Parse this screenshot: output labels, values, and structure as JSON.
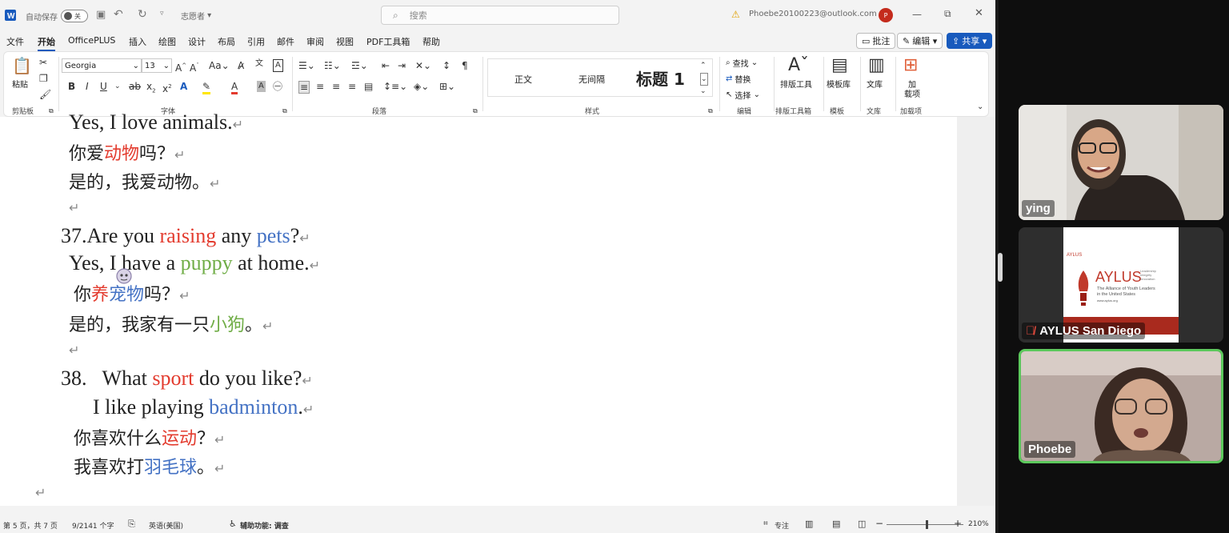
{
  "titlebar": {
    "autosave_label": "自动保存",
    "autosave_state": "关",
    "doc_name": "志愿者",
    "search_placeholder": "搜索",
    "account": "Phoebe20100223@outlook.com",
    "avatar_letter": "P"
  },
  "menu": [
    "文件",
    "开始",
    "OfficePLUS",
    "插入",
    "绘图",
    "设计",
    "布局",
    "引用",
    "邮件",
    "审阅",
    "视图",
    "PDF工具箱",
    "帮助"
  ],
  "menu_active": "开始",
  "top_buttons": {
    "comment": "批注",
    "edit": "编辑",
    "share": "共享"
  },
  "ribbon": {
    "paste": "粘贴",
    "font_name": "Georgia",
    "font_size": "13",
    "styles": [
      "正文",
      "无间隔",
      "标题 1"
    ],
    "find": "查找",
    "replace": "替换",
    "select": "选择",
    "layout_tool": "排版工具",
    "template_lib": "模板库",
    "library": "文库",
    "addins_1": "加",
    "addins_2": "载项",
    "groups": {
      "clipboard": "剪贴板",
      "font": "字体",
      "paragraph": "段落",
      "styles": "样式",
      "editing": "编辑",
      "layout": "排版工具箱",
      "template": "模板",
      "library": "文库",
      "addins": "加载项"
    }
  },
  "document": {
    "l1": "Yes, I love animals.",
    "l2a": "你爱",
    "l2b": "动物",
    "l2c": "吗？",
    "l3": "是的，我爱动物。",
    "l5a": "37.Are you ",
    "l5b": "raising",
    "l5c": " any ",
    "l5d": "pets",
    "l5e": "?",
    "l6a": "Yes, I have a ",
    "l6b": "puppy",
    "l6c": " at home.",
    "l7a": "你",
    "l7b": "养",
    "l7c": "宠物",
    "l7d": "吗？",
    "l8a": "是的，我家有一只",
    "l8b": "小狗",
    "l8c": "。",
    "l10a": "38.   What ",
    "l10b": "sport",
    "l10c": " do you like?",
    "l11a": "I like playing ",
    "l11b": "badminton",
    "l11c": ".",
    "l12a": "你喜欢什么",
    "l12b": "运动",
    "l12c": "？",
    "l13a": "我喜欢打",
    "l13b": "羽毛球",
    "l13c": "。",
    "para_mark": "↵"
  },
  "status": {
    "page": "第 5 页，共 7 页",
    "words": "9/2141 个字",
    "lang": "英语(美国)",
    "accessibility": "辅助功能: 调查",
    "focus": "专注",
    "zoom": "210%",
    "zoom_fraction": 0.52
  },
  "participants": [
    {
      "name": "ying"
    },
    {
      "name": "AYLUS San Diego",
      "muted": true
    },
    {
      "name": "Phoebe",
      "speaking": true
    }
  ],
  "aylus_card": {
    "small": "AYLUS",
    "brand": "AYLUS",
    "tagline_1": "Leadership",
    "tagline_2": "Integrity",
    "tagline_3": "Innovation",
    "subtitle_1": "The Alliance of Youth Leaders",
    "subtitle_2": "in the United States",
    "url": "www.aylus.org"
  },
  "colors": {
    "red": "#e33b2e",
    "blue": "#4472c4",
    "green": "#70ad47",
    "share": "#185abd",
    "speaking_border": "#5cc85c"
  }
}
